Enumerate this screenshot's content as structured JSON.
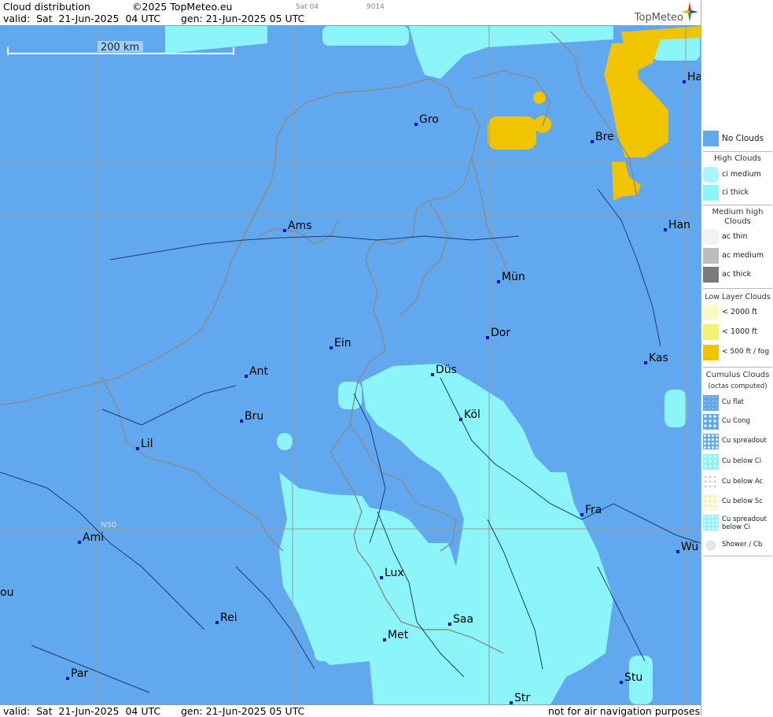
{
  "header": {
    "title": "Cloud distribution",
    "copyright": "©2025 TopMeteo.eu",
    "product_code": "Sat 04",
    "product_id": "9014",
    "valid": "valid:  Sat  21-Jun-2025  04 UTC",
    "gen": "gen: 21-Jun-2025 05 UTC",
    "logo": "TopMeteo"
  },
  "footer": {
    "valid": "valid:  Sat  21-Jun-2025  04 UTC",
    "gen": "gen: 21-Jun-2025 05 UTC",
    "disclaimer": "not for air navigation purposes"
  },
  "map": {
    "scale_label": "200 km",
    "lat_label": "N50",
    "colors": {
      "no_clouds": "#62a8ee",
      "ci": "#8cf5fa",
      "low_fog": "#f0c400",
      "borders": "#8a8a8a",
      "rivers": "#1c3a78",
      "grid": "#9a9a9a",
      "city_dot": "#1010cc"
    },
    "cities": [
      {
        "name": "Gro"
      },
      {
        "name": "Bre"
      },
      {
        "name": "Ha"
      },
      {
        "name": "Ams"
      },
      {
        "name": "Han"
      },
      {
        "name": "Mün"
      },
      {
        "name": "Ein"
      },
      {
        "name": "Dor"
      },
      {
        "name": "Ant"
      },
      {
        "name": "Düs"
      },
      {
        "name": "Kas"
      },
      {
        "name": "Bru"
      },
      {
        "name": "Köl"
      },
      {
        "name": "Lil"
      },
      {
        "name": "Fra"
      },
      {
        "name": "Ami"
      },
      {
        "name": "Wü"
      },
      {
        "name": "Lux"
      },
      {
        "name": "ou"
      },
      {
        "name": "Rei"
      },
      {
        "name": "Saa"
      },
      {
        "name": "Met"
      },
      {
        "name": "Par"
      },
      {
        "name": "Stu"
      },
      {
        "name": "Str"
      }
    ]
  },
  "legend": {
    "no_clouds": "No Clouds",
    "high": {
      "title": "High Clouds",
      "items": [
        "ci medium",
        "ci thick"
      ]
    },
    "medium": {
      "title": "Medium high Clouds",
      "items": [
        "ac thin",
        "ac medium",
        "ac thick"
      ]
    },
    "low": {
      "title": "Low Layer Clouds",
      "items": [
        "< 2000 ft",
        "< 1000 ft",
        "< 500 ft / fog"
      ]
    },
    "cumulus": {
      "title": "Cumulus Clouds",
      "subtitle": "(octas computed)",
      "items": [
        "Cu flat",
        "Cu Cong",
        "Cu spreadout",
        "Cu below Ci",
        "Cu below Ac",
        "Cu below Sc",
        "Cu spreadout below Ci",
        "Shower / Cb"
      ]
    }
  }
}
